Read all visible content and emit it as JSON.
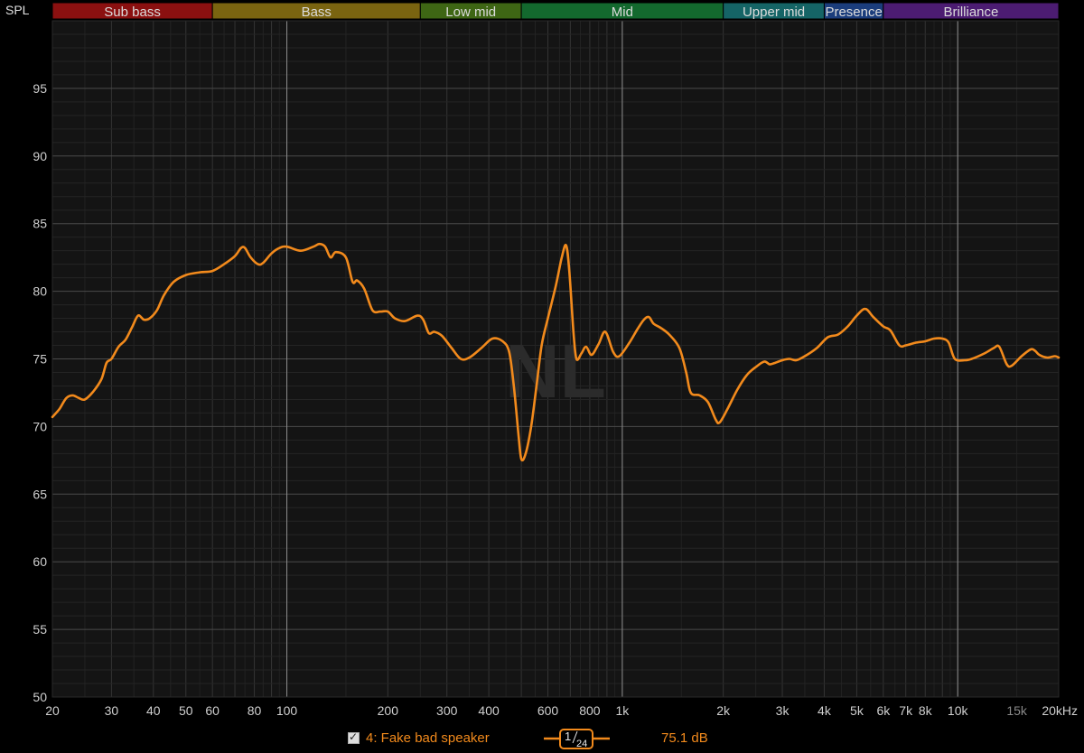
{
  "chart_data": {
    "type": "line",
    "ylabel": "SPL",
    "xscale": "log",
    "xlim": [
      20,
      20000
    ],
    "ylim": [
      50,
      100
    ],
    "grid": true,
    "watermark": "NL",
    "bands": [
      {
        "label": "Sub bass",
        "from": 20,
        "to": 60,
        "color": "#8b1010"
      },
      {
        "label": "Bass",
        "from": 60,
        "to": 250,
        "color": "#7a6410"
      },
      {
        "label": "Low mid",
        "from": 250,
        "to": 500,
        "color": "#3e6614"
      },
      {
        "label": "Mid",
        "from": 500,
        "to": 2000,
        "color": "#13692e"
      },
      {
        "label": "Upper mid",
        "from": 2000,
        "to": 4000,
        "color": "#156466"
      },
      {
        "label": "Presence",
        "from": 4000,
        "to": 6000,
        "color": "#1b3d7c"
      },
      {
        "label": "Brilliance",
        "from": 6000,
        "to": 20000,
        "color": "#4c1c72"
      }
    ],
    "y_ticks": [
      50,
      55,
      60,
      65,
      70,
      75,
      80,
      85,
      90,
      95
    ],
    "x_ticks": [
      {
        "v": 20,
        "label": "20"
      },
      {
        "v": 30,
        "label": "30"
      },
      {
        "v": 40,
        "label": "40"
      },
      {
        "v": 50,
        "label": "50"
      },
      {
        "v": 60,
        "label": "60"
      },
      {
        "v": 80,
        "label": "80"
      },
      {
        "v": 100,
        "label": "100"
      },
      {
        "v": 200,
        "label": "200"
      },
      {
        "v": 300,
        "label": "300"
      },
      {
        "v": 400,
        "label": "400"
      },
      {
        "v": 600,
        "label": "600"
      },
      {
        "v": 800,
        "label": "800"
      },
      {
        "v": 1000,
        "label": "1k"
      },
      {
        "v": 2000,
        "label": "2k"
      },
      {
        "v": 3000,
        "label": "3k"
      },
      {
        "v": 4000,
        "label": "4k"
      },
      {
        "v": 5000,
        "label": "5k"
      },
      {
        "v": 6000,
        "label": "6k"
      },
      {
        "v": 7000,
        "label": "7k"
      },
      {
        "v": 8000,
        "label": "8k"
      },
      {
        "v": 10000,
        "label": "10k"
      },
      {
        "v": 15000,
        "label": "15k",
        "faint": true
      },
      {
        "v": 20000,
        "label": "20kHz"
      }
    ],
    "series": [
      {
        "name": "4: Fake bad speaker",
        "color": "#f28a1c",
        "points": [
          [
            20,
            70.7
          ],
          [
            21,
            71.3
          ],
          [
            22,
            72.1
          ],
          [
            23,
            72.3
          ],
          [
            24,
            72.1
          ],
          [
            25,
            72.0
          ],
          [
            26.5,
            72.6
          ],
          [
            28,
            73.5
          ],
          [
            29,
            74.7
          ],
          [
            30,
            75.0
          ],
          [
            31.5,
            75.9
          ],
          [
            33,
            76.4
          ],
          [
            34.5,
            77.3
          ],
          [
            36,
            78.2
          ],
          [
            37.5,
            77.9
          ],
          [
            39,
            78.0
          ],
          [
            41,
            78.6
          ],
          [
            43,
            79.7
          ],
          [
            46,
            80.7
          ],
          [
            50,
            81.2
          ],
          [
            55,
            81.4
          ],
          [
            60,
            81.5
          ],
          [
            65,
            82.0
          ],
          [
            70,
            82.6
          ],
          [
            73,
            83.2
          ],
          [
            75,
            83.2
          ],
          [
            78,
            82.5
          ],
          [
            82,
            82.0
          ],
          [
            85,
            82.1
          ],
          [
            90,
            82.8
          ],
          [
            95,
            83.2
          ],
          [
            100,
            83.3
          ],
          [
            110,
            83.0
          ],
          [
            120,
            83.3
          ],
          [
            125,
            83.5
          ],
          [
            130,
            83.3
          ],
          [
            135,
            82.5
          ],
          [
            140,
            82.9
          ],
          [
            150,
            82.5
          ],
          [
            157,
            80.7
          ],
          [
            162,
            80.8
          ],
          [
            170,
            80.2
          ],
          [
            180,
            78.6
          ],
          [
            190,
            78.5
          ],
          [
            200,
            78.5
          ],
          [
            210,
            78.0
          ],
          [
            225,
            77.8
          ],
          [
            245,
            78.2
          ],
          [
            255,
            77.9
          ],
          [
            265,
            76.9
          ],
          [
            275,
            77.0
          ],
          [
            290,
            76.7
          ],
          [
            310,
            75.8
          ],
          [
            330,
            75.0
          ],
          [
            350,
            75.1
          ],
          [
            380,
            75.8
          ],
          [
            410,
            76.5
          ],
          [
            440,
            76.3
          ],
          [
            460,
            75.5
          ],
          [
            475,
            73.0
          ],
          [
            490,
            69.5
          ],
          [
            500,
            67.6
          ],
          [
            515,
            68.0
          ],
          [
            535,
            70.0
          ],
          [
            555,
            73.0
          ],
          [
            575,
            76.0
          ],
          [
            600,
            78.0
          ],
          [
            635,
            80.5
          ],
          [
            660,
            82.5
          ],
          [
            680,
            83.4
          ],
          [
            695,
            81.5
          ],
          [
            715,
            77.0
          ],
          [
            730,
            75.0
          ],
          [
            755,
            75.4
          ],
          [
            780,
            75.9
          ],
          [
            810,
            75.3
          ],
          [
            850,
            76.1
          ],
          [
            890,
            77.0
          ],
          [
            940,
            75.5
          ],
          [
            980,
            75.2
          ],
          [
            1050,
            76.2
          ],
          [
            1110,
            77.2
          ],
          [
            1160,
            77.9
          ],
          [
            1200,
            78.1
          ],
          [
            1240,
            77.6
          ],
          [
            1300,
            77.3
          ],
          [
            1380,
            76.8
          ],
          [
            1480,
            75.8
          ],
          [
            1550,
            74.0
          ],
          [
            1600,
            72.5
          ],
          [
            1700,
            72.3
          ],
          [
            1800,
            71.8
          ],
          [
            1900,
            70.5
          ],
          [
            1950,
            70.3
          ],
          [
            2050,
            71.2
          ],
          [
            2200,
            72.7
          ],
          [
            2350,
            73.8
          ],
          [
            2500,
            74.4
          ],
          [
            2650,
            74.8
          ],
          [
            2750,
            74.6
          ],
          [
            2850,
            74.7
          ],
          [
            3000,
            74.9
          ],
          [
            3150,
            75.0
          ],
          [
            3300,
            74.9
          ],
          [
            3500,
            75.2
          ],
          [
            3800,
            75.8
          ],
          [
            4100,
            76.6
          ],
          [
            4400,
            76.8
          ],
          [
            4700,
            77.4
          ],
          [
            5000,
            78.2
          ],
          [
            5300,
            78.7
          ],
          [
            5600,
            78.1
          ],
          [
            6000,
            77.4
          ],
          [
            6300,
            77.1
          ],
          [
            6700,
            76.0
          ],
          [
            7000,
            76.0
          ],
          [
            7500,
            76.2
          ],
          [
            8000,
            76.3
          ],
          [
            8500,
            76.5
          ],
          [
            9000,
            76.5
          ],
          [
            9400,
            76.2
          ],
          [
            9800,
            75.0
          ],
          [
            10500,
            74.9
          ],
          [
            11000,
            75.0
          ],
          [
            12000,
            75.4
          ],
          [
            12800,
            75.8
          ],
          [
            13300,
            75.9
          ],
          [
            14000,
            74.6
          ],
          [
            14500,
            74.5
          ],
          [
            15500,
            75.2
          ],
          [
            16500,
            75.7
          ],
          [
            17000,
            75.6
          ],
          [
            17500,
            75.3
          ],
          [
            18500,
            75.1
          ],
          [
            19500,
            75.2
          ],
          [
            20000,
            75.1
          ]
        ]
      }
    ]
  },
  "legend": {
    "checked": true,
    "name": "4: Fake bad speaker",
    "smoothing_numerator": "1",
    "smoothing_denominator": "24",
    "value": "75.1 dB"
  }
}
